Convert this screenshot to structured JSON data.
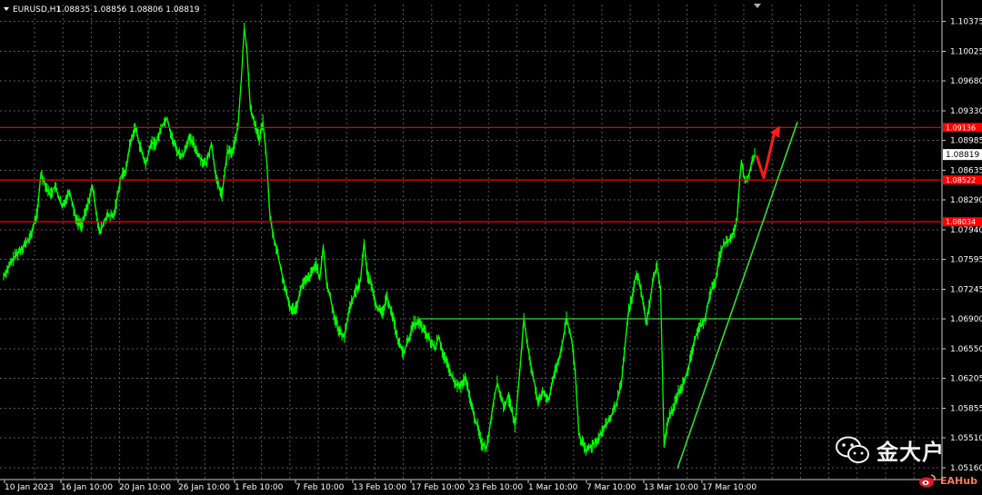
{
  "header": {
    "symbol_text": "EURUSD,H1",
    "ohlc_text": "1.08835 1.08856 1.08806 1.08819"
  },
  "colors": {
    "background": "#000000",
    "candle": "#00ff00",
    "grid": "#5a5a5a",
    "level_line": "#ff0000",
    "trend_line": "#2ee02e",
    "arrow": "#ff1a1a",
    "axis_text": "#ffffff",
    "current_price_box": "#ffffff"
  },
  "chart_data": {
    "type": "line",
    "symbol": "EURUSD",
    "timeframe": "H1",
    "y_ticks": [
      "1.10375",
      "1.10025",
      "1.09680",
      "1.09330",
      "1.08985",
      "1.08635",
      "1.08290",
      "1.07940",
      "1.07595",
      "1.07245",
      "1.06900",
      "1.06550",
      "1.06205",
      "1.05855",
      "1.05510",
      "1.05160"
    ],
    "x_ticks": [
      "10 Jan 2023",
      "16 Jan 10:00",
      "20 Jan 10:00",
      "26 Jan 10:00",
      "1 Feb 10:00",
      "7 Feb 10:00",
      "13 Feb 10:00",
      "17 Feb 10:00",
      "23 Feb 10:00",
      "1 Mar 10:00",
      "7 Mar 10:00",
      "13 Mar 10:00",
      "17 Mar 10:00"
    ],
    "ylim": [
      1.0505,
      1.105
    ],
    "current_price": "1.08819",
    "levels": [
      {
        "price": 1.09136,
        "label": "1.09136"
      },
      {
        "price": 1.08522,
        "label": "1.08522"
      },
      {
        "price": 1.08034,
        "label": "1.08034"
      }
    ],
    "support_line": {
      "price": 1.069
    },
    "trendline": {
      "from": {
        "x": "14 Mar 2023",
        "price": 1.0515
      },
      "to": {
        "x": "22 Mar 2023",
        "price": 1.092
      }
    },
    "series": [
      {
        "values": [
          [
            0,
            1.074
          ],
          [
            12,
            1.0762
          ],
          [
            30,
            1.0785
          ],
          [
            38,
            1.0815
          ],
          [
            42,
            1.086
          ],
          [
            46,
            1.085
          ],
          [
            52,
            1.0835
          ],
          [
            58,
            1.0845
          ],
          [
            66,
            1.082
          ],
          [
            74,
            1.084
          ],
          [
            82,
            1.0805
          ],
          [
            88,
            1.08
          ],
          [
            94,
            1.082
          ],
          [
            100,
            1.0845
          ],
          [
            108,
            1.079
          ],
          [
            116,
            1.081
          ],
          [
            124,
            1.081
          ],
          [
            132,
            1.0855
          ],
          [
            138,
            1.0865
          ],
          [
            142,
            1.0892
          ],
          [
            148,
            1.0915
          ],
          [
            154,
            1.089
          ],
          [
            160,
            1.087
          ],
          [
            166,
            1.0895
          ],
          [
            172,
            1.0895
          ],
          [
            178,
            1.0915
          ],
          [
            184,
            1.0925
          ],
          [
            190,
            1.09
          ],
          [
            196,
            1.0885
          ],
          [
            202,
            1.088
          ],
          [
            208,
            1.09
          ],
          [
            214,
            1.0895
          ],
          [
            220,
            1.088
          ],
          [
            228,
            1.087
          ],
          [
            234,
            1.0895
          ],
          [
            240,
            1.085
          ],
          [
            246,
            1.0835
          ],
          [
            252,
            1.0885
          ],
          [
            258,
            1.0885
          ],
          [
            264,
            1.0915
          ],
          [
            268,
            1.0975
          ],
          [
            271,
            1.103
          ],
          [
            274,
            1.1005
          ],
          [
            278,
            1.0935
          ],
          [
            284,
            1.0915
          ],
          [
            288,
            1.09
          ],
          [
            292,
            1.092
          ],
          [
            296,
            1.088
          ],
          [
            300,
            1.081
          ],
          [
            304,
            1.0785
          ],
          [
            308,
            1.077
          ],
          [
            314,
            1.074
          ],
          [
            318,
            1.072
          ],
          [
            324,
            1.07
          ],
          [
            330,
            1.0705
          ],
          [
            336,
            1.073
          ],
          [
            342,
            1.0735
          ],
          [
            348,
            1.0745
          ],
          [
            352,
            1.0755
          ],
          [
            356,
            1.0735
          ],
          [
            360,
            1.0775
          ],
          [
            364,
            1.073
          ],
          [
            368,
            1.0715
          ],
          [
            372,
            1.0695
          ],
          [
            378,
            1.0675
          ],
          [
            384,
            1.067
          ],
          [
            390,
            1.0705
          ],
          [
            396,
            1.072
          ],
          [
            402,
            1.0735
          ],
          [
            406,
            1.078
          ],
          [
            410,
            1.074
          ],
          [
            414,
            1.073
          ],
          [
            420,
            1.0705
          ],
          [
            426,
            1.0695
          ],
          [
            432,
            1.0715
          ],
          [
            438,
            1.0695
          ],
          [
            444,
            1.0665
          ],
          [
            450,
            1.065
          ],
          [
            456,
            1.0665
          ],
          [
            462,
            1.0685
          ],
          [
            468,
            1.0685
          ],
          [
            474,
            1.0675
          ],
          [
            480,
            1.0665
          ],
          [
            486,
            1.0655
          ],
          [
            490,
            1.067
          ],
          [
            496,
            1.0645
          ],
          [
            502,
            1.063
          ],
          [
            508,
            1.0615
          ],
          [
            514,
            1.061
          ],
          [
            520,
            1.062
          ],
          [
            526,
            1.0595
          ],
          [
            530,
            1.0575
          ],
          [
            534,
            1.0565
          ],
          [
            538,
            1.0545
          ],
          [
            544,
            1.054
          ],
          [
            548,
            1.0565
          ],
          [
            552,
            1.0595
          ],
          [
            556,
            1.0615
          ],
          [
            560,
            1.06
          ],
          [
            564,
            1.0585
          ],
          [
            568,
            1.06
          ],
          [
            572,
            1.0585
          ],
          [
            576,
            1.0565
          ],
          [
            582,
            1.0635
          ],
          [
            586,
            1.069
          ],
          [
            590,
            1.066
          ],
          [
            594,
            1.0635
          ],
          [
            598,
            1.0615
          ],
          [
            602,
            1.059
          ],
          [
            608,
            1.0605
          ],
          [
            614,
            1.0595
          ],
          [
            620,
            1.0625
          ],
          [
            626,
            1.0645
          ],
          [
            630,
            1.0665
          ],
          [
            634,
            1.069
          ],
          [
            640,
            1.0665
          ],
          [
            644,
            1.0625
          ],
          [
            648,
            1.0555
          ],
          [
            652,
            1.0545
          ],
          [
            656,
            1.0535
          ],
          [
            660,
            1.054
          ],
          [
            666,
            1.0545
          ],
          [
            672,
            1.0555
          ],
          [
            678,
            1.0565
          ],
          [
            684,
            1.0575
          ],
          [
            690,
            1.059
          ],
          [
            696,
            1.0615
          ],
          [
            700,
            1.066
          ],
          [
            704,
            1.07
          ],
          [
            708,
            1.0715
          ],
          [
            712,
            1.074
          ],
          [
            716,
            1.0735
          ],
          [
            720,
            1.071
          ],
          [
            724,
            1.0685
          ],
          [
            728,
            1.071
          ],
          [
            732,
            1.074
          ],
          [
            736,
            1.075
          ],
          [
            740,
            1.0725
          ],
          [
            744,
            1.054
          ],
          [
            748,
            1.057
          ],
          [
            754,
            1.0585
          ],
          [
            760,
            1.0605
          ],
          [
            766,
            1.0615
          ],
          [
            772,
            1.0635
          ],
          [
            778,
            1.0665
          ],
          [
            784,
            1.068
          ],
          [
            790,
            1.069
          ],
          [
            796,
            1.072
          ],
          [
            802,
            1.0735
          ],
          [
            806,
            1.076
          ],
          [
            810,
            1.0775
          ],
          [
            814,
            1.078
          ],
          [
            818,
            1.0782
          ],
          [
            822,
            1.079
          ],
          [
            826,
            1.0805
          ],
          [
            829,
            1.085
          ],
          [
            831,
            1.0875
          ],
          [
            834,
            1.0855
          ],
          [
            836,
            1.085
          ],
          [
            840,
            1.086
          ],
          [
            843,
            1.0875
          ],
          [
            846,
            1.0882
          ]
        ]
      }
    ]
  },
  "watermarks": [
    {
      "icon": "wechat-icon",
      "text": "金大户"
    },
    {
      "icon": "weibo-icon",
      "text": "EAHub"
    }
  ]
}
